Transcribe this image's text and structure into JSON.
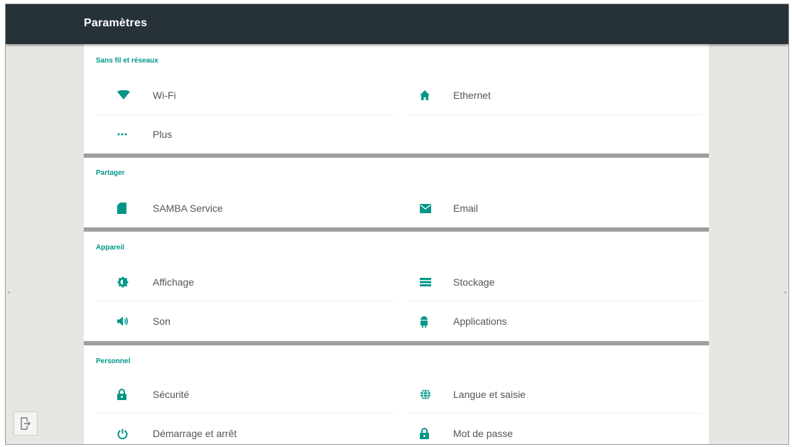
{
  "header": {
    "title": "Paramètres"
  },
  "sections": [
    {
      "title": "Sans fil et réseaux",
      "items": [
        {
          "label": "Wi-Fi",
          "icon": "wifi-icon"
        },
        {
          "label": "Ethernet",
          "icon": "home-icon"
        },
        {
          "label": "Plus",
          "icon": "more-dots-icon"
        }
      ]
    },
    {
      "title": "Partager",
      "items": [
        {
          "label": "SAMBA Service",
          "icon": "sd-card-icon"
        },
        {
          "label": "Email",
          "icon": "email-icon"
        }
      ]
    },
    {
      "title": "Appareil",
      "items": [
        {
          "label": "Affichage",
          "icon": "brightness-icon"
        },
        {
          "label": "Stockage",
          "icon": "storage-icon"
        },
        {
          "label": "Son",
          "icon": "volume-icon"
        },
        {
          "label": "Applications",
          "icon": "android-icon"
        }
      ]
    },
    {
      "title": "Personnel",
      "items": [
        {
          "label": "Sécurité",
          "icon": "lock-icon"
        },
        {
          "label": "Langue et saisie",
          "icon": "globe-icon"
        },
        {
          "label": "Démarrage et arrêt",
          "icon": "power-icon"
        },
        {
          "label": "Mot de passe",
          "icon": "lock-icon"
        }
      ]
    }
  ],
  "colors": {
    "accent": "#009688",
    "topbar": "#263238",
    "background": "#e6e6e3",
    "divider": "#9e9e9e"
  }
}
